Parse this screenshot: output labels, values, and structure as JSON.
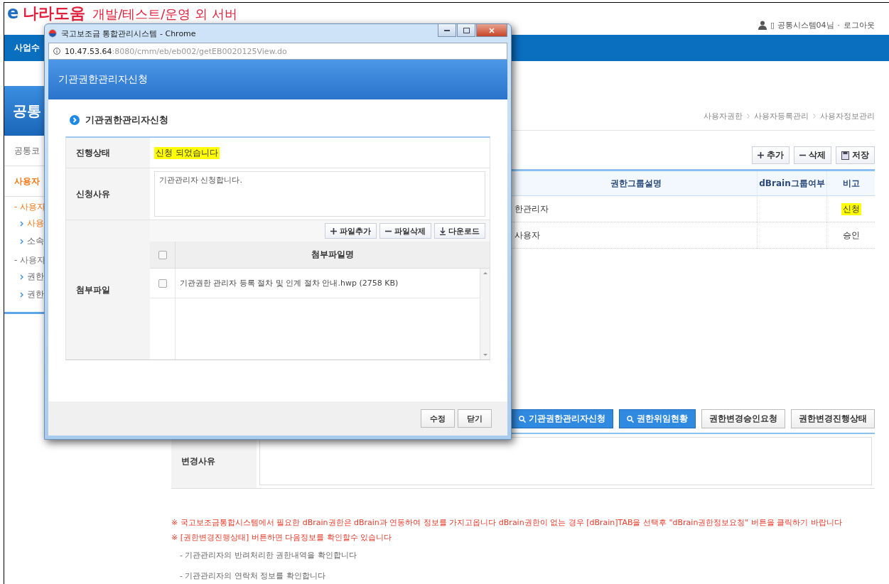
{
  "header": {
    "logo_prefix": "e",
    "logo_name": "나라도움",
    "server_note": "개발/테스트/운영 외 서버",
    "user": "▯ 공통시스템04님",
    "separator": "·",
    "logout": "로그아웃"
  },
  "nav": {
    "items": [
      "사업수"
    ]
  },
  "sidebar": {
    "title": "공통",
    "items": [
      {
        "label": "공통코",
        "kind": "menu",
        "selected": false
      },
      {
        "label": "사용자",
        "kind": "menu",
        "selected": true
      },
      {
        "label": "- 사용자",
        "kind": "group",
        "selected": true
      },
      {
        "label": "사용",
        "kind": "sub",
        "selected": true
      },
      {
        "label": "소속",
        "kind": "sub",
        "selected": false
      },
      {
        "label": "- 사용자",
        "kind": "group",
        "selected": false
      },
      {
        "label": "권한",
        "kind": "sub",
        "selected": false
      },
      {
        "label": "권한",
        "kind": "sub",
        "selected": false
      }
    ]
  },
  "breadcrumb": [
    "사용자권한",
    "사용자등록관리",
    "사용자정보관리"
  ],
  "toolbar": [
    "추가",
    "삭제",
    "저장"
  ],
  "table": {
    "columns": [
      "권한그룹설명",
      "dBrain그룹여부",
      "비고"
    ],
    "rows": [
      {
        "description": "한관리자",
        "remark": "신청",
        "highlighted": true
      },
      {
        "description": "사용자",
        "remark": "승인",
        "highlighted": false
      }
    ]
  },
  "action_buttons": [
    {
      "label": "기관권한관리자신청",
      "kind": "primary"
    },
    {
      "label": "권한위임현황",
      "kind": "primary"
    },
    {
      "label": "권한변경승인요청",
      "kind": "default"
    },
    {
      "label": "권한변경진행상태",
      "kind": "default"
    }
  ],
  "change_form": {
    "label": "변경사유"
  },
  "notes": [
    {
      "kind": "note",
      "text": "※ 국고보조금통합시스템에서 필요한 dBrain권한은 dBrain과 연동하여 정보를 가지고옵니다 dBrain권한이 없는 경우 [dBrain]TAB을 선택후 \"dBrain권한정보요청\" 버튼을 클릭하기 바랍니다"
    },
    {
      "kind": "note",
      "text": "※ [권한변경진행상태] 버튼하면 다음정보를 확인할수 있습니다"
    },
    {
      "kind": "sub",
      "text": "- 기관관리자의 반려처리한 권한내역을 확인합니다"
    },
    {
      "kind": "sub",
      "text": "- 기관관리자의 연락처 정보를 확인합니다"
    }
  ],
  "popup": {
    "window_title": "국고보조금 통합관리시스템 - Chrome",
    "url_host": "10.47.53.64",
    "url_path": ":8080/cmm/eb/eb002/getEB0020125View.do",
    "header": "기관권한관리자신청",
    "section_title": "기관권한관리자신청",
    "status": {
      "label": "진행상태",
      "value": "신청 되었습니다"
    },
    "reason": {
      "label": "신청사유",
      "value": "기관관리자 신청합니다."
    },
    "attachments": {
      "label": "첨부파일",
      "buttons": [
        "파일추가",
        "파일삭제",
        "다운로드"
      ],
      "column": "첨부파일명",
      "header_checked": false,
      "files": [
        {
          "name": "기관권한 관리자 등록 절차 및 인계 절차 안내.hwp (2758 KB)",
          "checked": false
        }
      ]
    },
    "buttons": [
      "수정",
      "닫기"
    ]
  }
}
